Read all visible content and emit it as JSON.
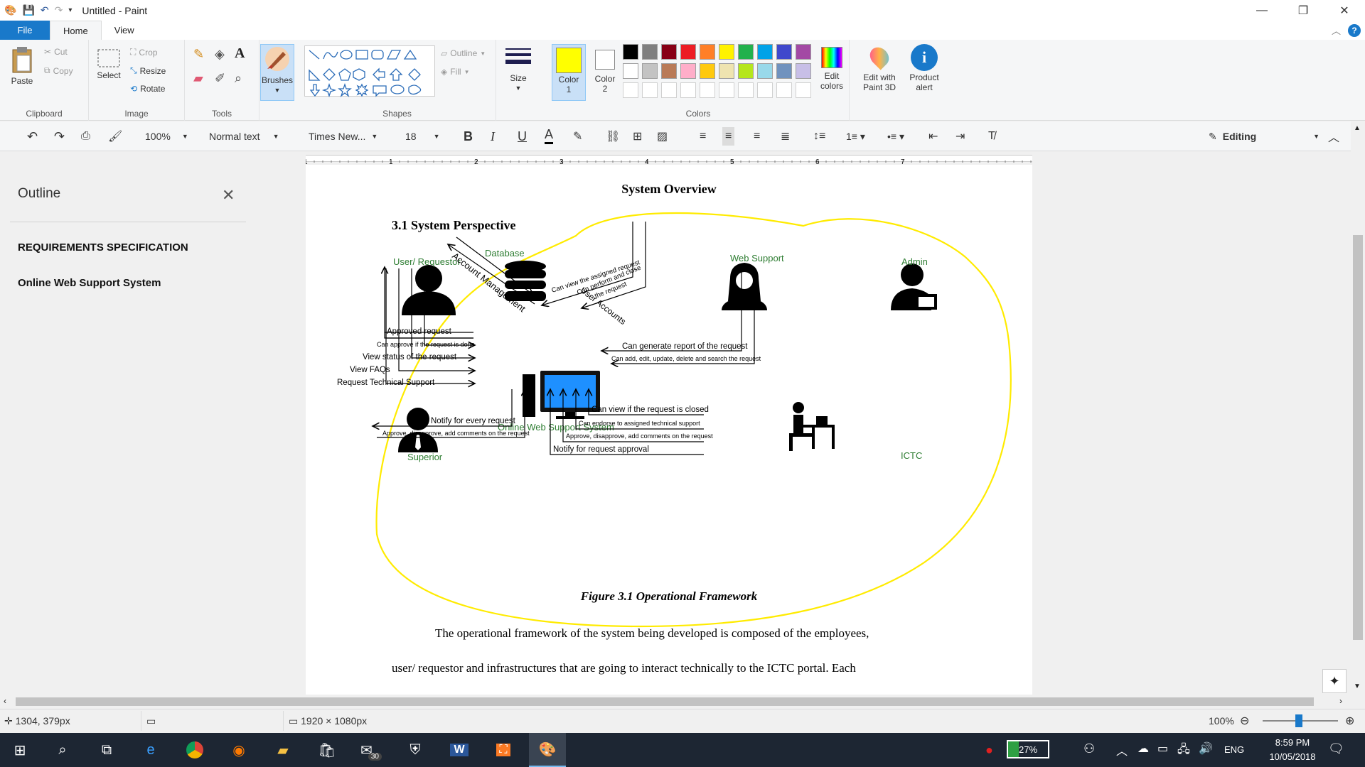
{
  "titlebar": {
    "title": "Untitled - Paint",
    "minimize": "—",
    "maximize": "❐",
    "close": "✕"
  },
  "tabs": {
    "file": "File",
    "home": "Home",
    "view": "View",
    "help": "?"
  },
  "ribbon": {
    "clipboard": {
      "label": "Clipboard",
      "paste": "Paste",
      "cut": "Cut",
      "copy": "Copy"
    },
    "image": {
      "label": "Image",
      "select": "Select",
      "crop": "Crop",
      "resize": "Resize",
      "rotate": "Rotate"
    },
    "tools": {
      "label": "Tools"
    },
    "brushes": "Brushes",
    "shapes": {
      "label": "Shapes",
      "outline": "Outline",
      "fill": "Fill"
    },
    "size": "Size",
    "colors": {
      "label": "Colors",
      "color1": "Color 1",
      "color2": "Color 2",
      "edit_colors": "Edit colors",
      "color1_value": "#ffff00",
      "color2_value": "#ffffff",
      "palette_row1": [
        "#000000",
        "#7f7f7f",
        "#880015",
        "#ed1c24",
        "#ff7f27",
        "#fff200",
        "#22b14c",
        "#00a2e8",
        "#3f48cc",
        "#a349a4"
      ],
      "palette_row2": [
        "#ffffff",
        "#c3c3c3",
        "#b97a57",
        "#ffaec9",
        "#ffc90e",
        "#efe4b0",
        "#b5e61d",
        "#99d9ea",
        "#7092be",
        "#c8bfe7"
      ]
    },
    "paint3d": "Edit with Paint 3D",
    "product_alert": "Product alert"
  },
  "format": {
    "zoom": "100%",
    "style": "Normal text",
    "font": "Times New...",
    "size": "18",
    "editing": "Editing"
  },
  "outline": {
    "title": "Outline",
    "items": [
      "REQUIREMENTS SPECIFICATION",
      "Online Web Support System"
    ]
  },
  "ruler": {
    "numbers": [
      "1",
      "1",
      "2",
      "3",
      "4",
      "5",
      "6",
      "7"
    ]
  },
  "doc": {
    "heading": "System Overview",
    "section": "3.1 System Perspective",
    "caption": "Figure 3.1 Operational Framework",
    "para1": "The operational framework of the system being developed is composed of the employees,",
    "para2": "user/ requestor and infrastructures that are going to interact technically to the ICTC portal. Each",
    "actors": {
      "user": "User/ Requestor",
      "database": "Database",
      "websupport": "Web Support",
      "admin": "Admin",
      "system": "Online Web Support System",
      "superior": "Superior",
      "ictc": "ICTC"
    },
    "flows": {
      "user_accounts": "User Accounts",
      "account_mgmt": "Account Management",
      "ws1": "Can view the assigned request",
      "ws2": "Can perform and close",
      "ws3": "the request",
      "approved": "Approved request",
      "can_approve": "Can approve if the request is done",
      "view_status": "View status of the request",
      "view_faqs": "View FAQs",
      "req_support": "Request Technical Support",
      "admin1": "Can generate report of the request",
      "admin2": "Can add, edit, update, delete and search the request",
      "ictc1": "Can view if the request is closed",
      "ictc2": "Can endorse to assigned technical support",
      "ictc3": "Approve, disapprove, add comments on the request",
      "ictc4": "Notify for request approval",
      "sup1": "Notify for every request",
      "sup2": "Approve, disapprove, add comments on the request"
    }
  },
  "status": {
    "cursor": "1304, 379px",
    "dimensions": "1920 × 1080px",
    "zoom": "100%"
  },
  "taskbar": {
    "battery": "27%",
    "lang": "ENG",
    "time": "8:59 PM",
    "date": "10/05/2018",
    "badge": "30"
  }
}
